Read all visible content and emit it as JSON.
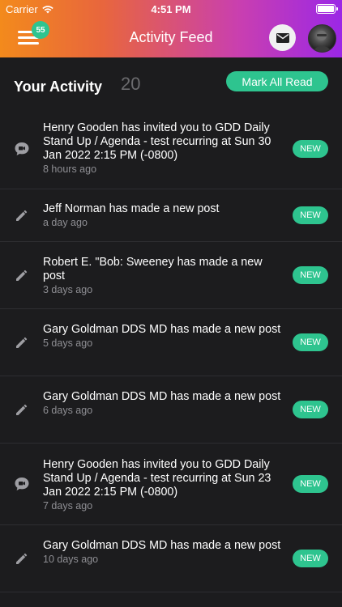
{
  "status": {
    "carrier": "Carrier",
    "time": "4:51 PM"
  },
  "header": {
    "title": "Activity Feed",
    "menu_badge": "55",
    "menu_icon": "hamburger-icon",
    "mail_icon": "mail-icon"
  },
  "section": {
    "title": "Your Activity",
    "count": "20",
    "mark_all_label": "Mark All Read"
  },
  "items": [
    {
      "icon": "video-chat-icon",
      "text": "Henry Gooden has invited you to GDD Daily Stand Up / Agenda - test recurring at Sun 30 Jan 2022 2:15 PM (-0800)",
      "time": "8 hours ago",
      "badge": "NEW"
    },
    {
      "icon": "pencil-icon",
      "text": "Jeff Norman has made a new post",
      "time": "a day ago",
      "badge": "NEW"
    },
    {
      "icon": "pencil-icon",
      "text": "Robert E. \"Bob: Sweeney has made a new post",
      "time": "3 days ago",
      "badge": "NEW"
    },
    {
      "icon": "pencil-icon",
      "text": "Gary Goldman DDS MD has made a new post",
      "time": "5 days ago",
      "badge": "NEW"
    },
    {
      "icon": "pencil-icon",
      "text": "Gary Goldman DDS MD has made a new post",
      "time": "6 days ago",
      "badge": "NEW"
    },
    {
      "icon": "video-chat-icon",
      "text": "Henry Gooden has invited you to GDD Daily Stand Up / Agenda - test recurring at Sun 23 Jan 2022 2:15 PM (-0800)",
      "time": "7 days ago",
      "badge": "NEW"
    },
    {
      "icon": "pencil-icon",
      "text": "Gary Goldman DDS MD has made a new post",
      "time": "10 days ago",
      "badge": "NEW"
    }
  ],
  "colors": {
    "accent": "#2ec48f",
    "background": "#1c1c1e",
    "gradient_start": "#f38a1c",
    "gradient_end": "#9b27e6"
  }
}
